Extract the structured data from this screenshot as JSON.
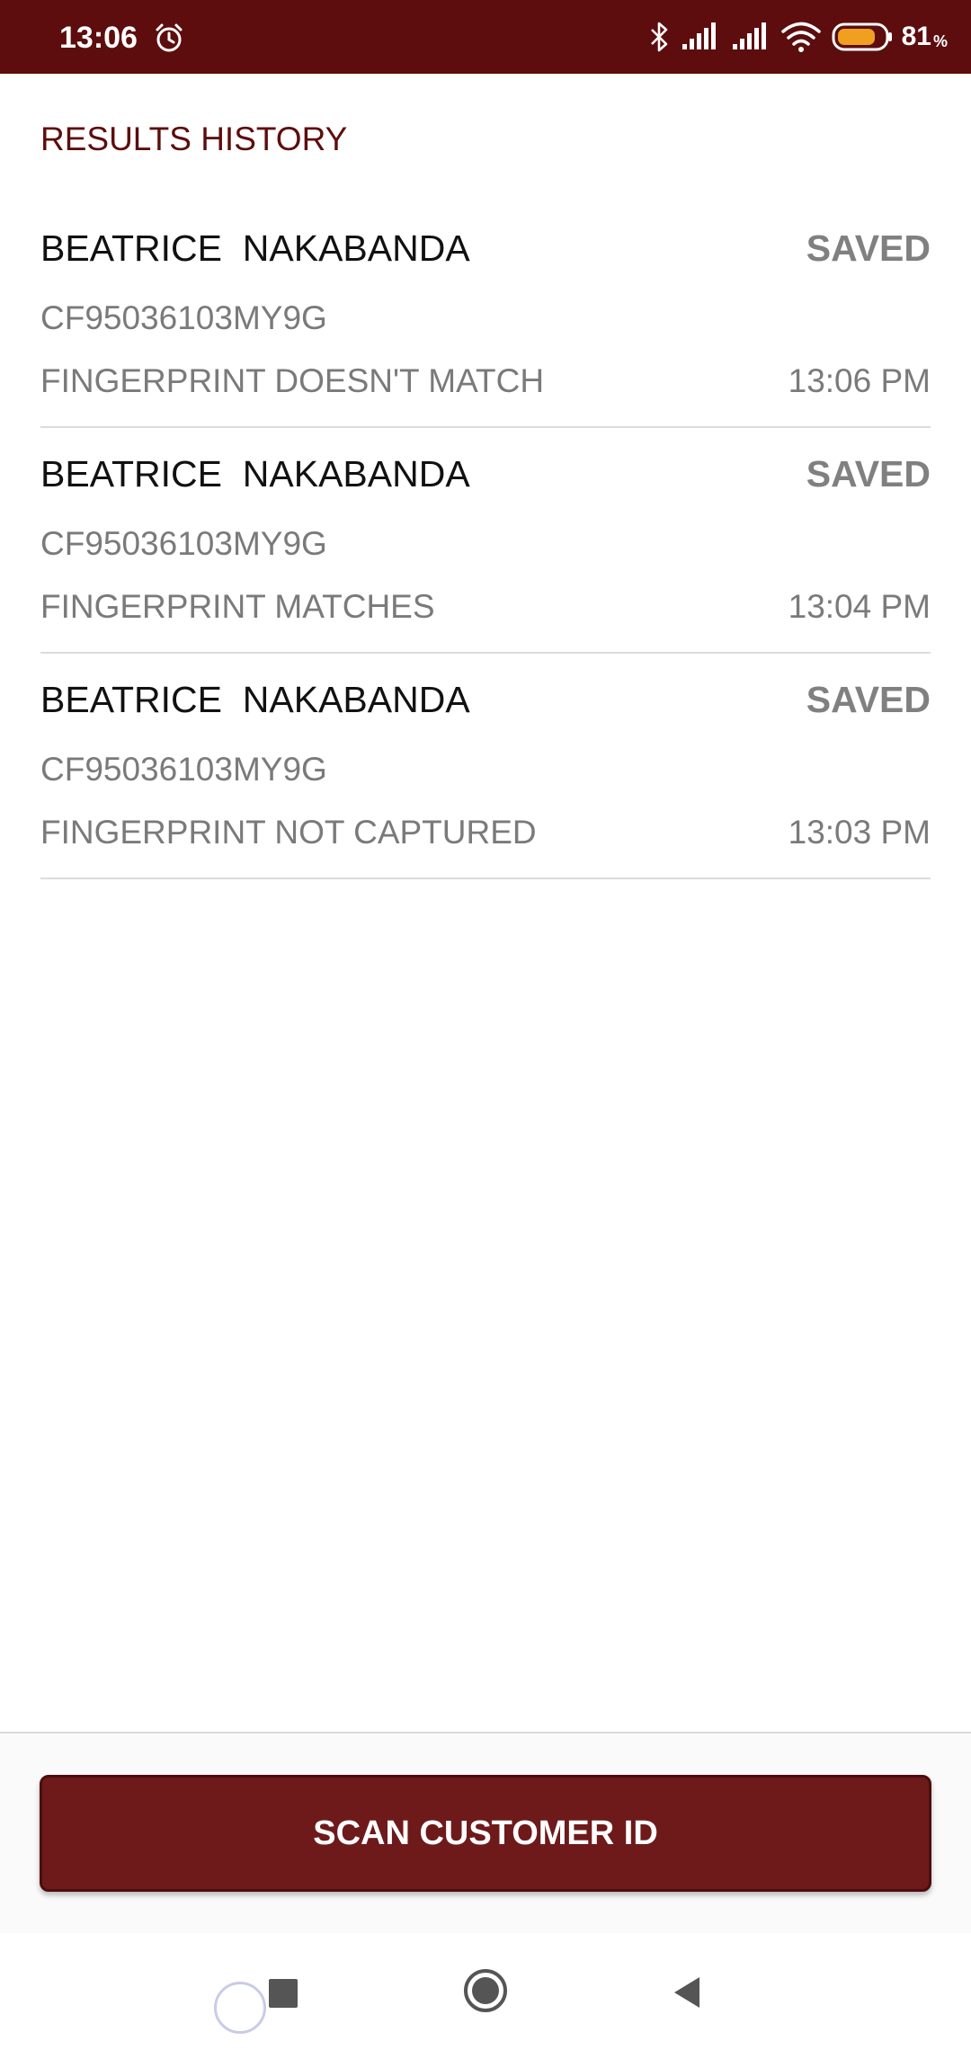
{
  "status_bar": {
    "time": "13:06",
    "alarm_icon": "alarm-clock-icon",
    "bluetooth_icon": "bluetooth-icon",
    "signal_icons": [
      "signal-icon",
      "signal-icon"
    ],
    "wifi_icon": "wifi-icon",
    "battery_icon": "battery-icon",
    "battery_color": "#f0a020",
    "battery_level": 0.81,
    "battery_percent": "81",
    "battery_percent_sign": "%"
  },
  "page": {
    "title": "RESULTS HISTORY",
    "accent_color": "#5d0d0d"
  },
  "history": {
    "items": [
      {
        "name": "BEATRICE  NAKABANDA",
        "status": "SAVED",
        "id": "CF95036103MY9G",
        "result": "FINGERPRINT DOESN'T MATCH",
        "time": "13:06 PM"
      },
      {
        "name": "BEATRICE  NAKABANDA",
        "status": "SAVED",
        "id": "CF95036103MY9G",
        "result": "FINGERPRINT MATCHES",
        "time": "13:04 PM"
      },
      {
        "name": "BEATRICE  NAKABANDA",
        "status": "SAVED",
        "id": "CF95036103MY9G",
        "result": "FINGERPRINT NOT CAPTURED",
        "time": "13:03 PM"
      }
    ]
  },
  "actions": {
    "scan_label": "SCAN CUSTOMER ID",
    "button_color": "#6e1a1a"
  },
  "nav_bar": {
    "recents_icon": "square-recents-icon",
    "home_icon": "circle-home-icon",
    "back_icon": "triangle-back-icon"
  }
}
